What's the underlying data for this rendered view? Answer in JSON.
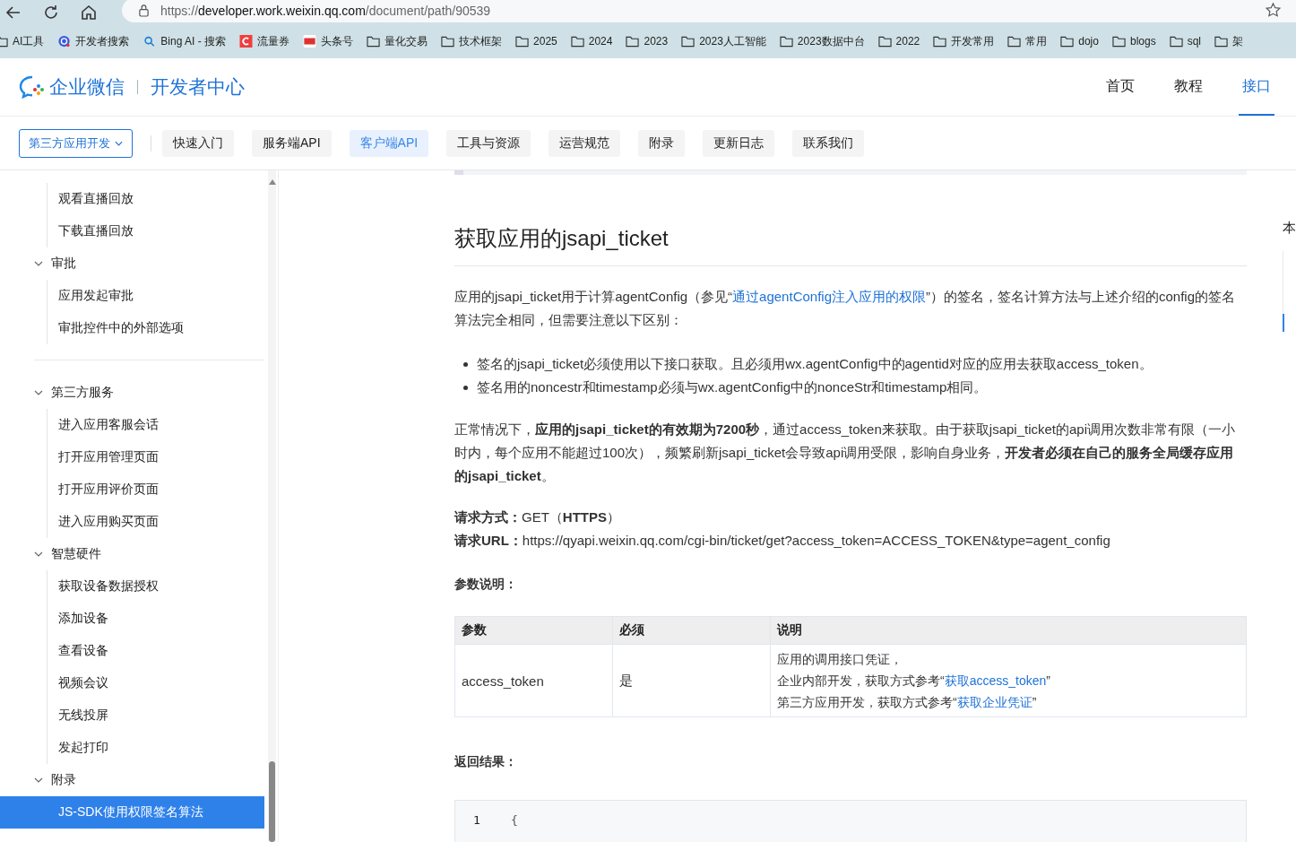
{
  "browser": {
    "url": {
      "scheme": "https://",
      "host": "developer.work.weixin.qq.com",
      "path": "/document/path/90539"
    },
    "bookmarks": [
      {
        "label": "AI工具",
        "kind": "folder"
      },
      {
        "label": "开发者搜索",
        "kind": "target"
      },
      {
        "label": "Bing AI - 搜索",
        "kind": "search"
      },
      {
        "label": "流量券",
        "kind": "c-logo"
      },
      {
        "label": "头条号",
        "kind": "news"
      },
      {
        "label": "量化交易",
        "kind": "folder"
      },
      {
        "label": "技术框架",
        "kind": "folder"
      },
      {
        "label": "2025",
        "kind": "folder"
      },
      {
        "label": "2024",
        "kind": "folder"
      },
      {
        "label": "2023",
        "kind": "folder"
      },
      {
        "label": "2023人工智能",
        "kind": "folder"
      },
      {
        "label": "2023数据中台",
        "kind": "folder"
      },
      {
        "label": "2022",
        "kind": "folder"
      },
      {
        "label": "开发常用",
        "kind": "folder"
      },
      {
        "label": "常用",
        "kind": "folder"
      },
      {
        "label": "dojo",
        "kind": "folder"
      },
      {
        "label": "blogs",
        "kind": "folder"
      },
      {
        "label": "sql",
        "kind": "folder"
      },
      {
        "label": "架",
        "kind": "folder"
      }
    ]
  },
  "header": {
    "brand": "企业微信",
    "section": "开发者中心",
    "nav": [
      {
        "label": "首页",
        "selected": false
      },
      {
        "label": "教程",
        "selected": false
      },
      {
        "label": "接口",
        "selected": true
      }
    ]
  },
  "subnav": {
    "dropdown": "第三方应用开发",
    "tabs": [
      {
        "label": "快速入门",
        "selected": false
      },
      {
        "label": "服务端API",
        "selected": false
      },
      {
        "label": "客户端API",
        "selected": true
      },
      {
        "label": "工具与资源",
        "selected": false
      },
      {
        "label": "运营规范",
        "selected": false
      },
      {
        "label": "附录",
        "selected": false
      },
      {
        "label": "更新日志",
        "selected": false
      },
      {
        "label": "联系我们",
        "selected": false
      }
    ]
  },
  "sidebar": {
    "tree": [
      {
        "children": [
          {
            "label": "观看直播回放",
            "selected": false
          },
          {
            "label": "下载直播回放",
            "selected": false
          }
        ]
      },
      {
        "label": "审批",
        "expanded": true,
        "children": [
          {
            "label": "应用发起审批",
            "selected": false
          },
          {
            "label": "审批控件中的外部选项",
            "selected": false
          }
        ]
      },
      {
        "kind": "divider"
      },
      {
        "label": "第三方服务",
        "expanded": true,
        "children": [
          {
            "label": "进入应用客服会话",
            "selected": false
          },
          {
            "label": "打开应用管理页面",
            "selected": false
          },
          {
            "label": "打开应用评价页面",
            "selected": false
          },
          {
            "label": "进入应用购买页面",
            "selected": false
          }
        ]
      },
      {
        "label": "智慧硬件",
        "expanded": true,
        "children": [
          {
            "label": "获取设备数据授权",
            "selected": false
          },
          {
            "label": "添加设备",
            "selected": false
          },
          {
            "label": "查看设备",
            "selected": false
          },
          {
            "label": "视频会议",
            "selected": false
          },
          {
            "label": "无线投屏",
            "selected": false
          },
          {
            "label": "发起打印",
            "selected": false
          }
        ]
      },
      {
        "label": "附录",
        "expanded": true,
        "children": [
          {
            "label": "JS-SDK使用权限签名算法",
            "selected": true
          }
        ]
      }
    ]
  },
  "article": {
    "title": "获取应用的jsapi_ticket",
    "intro": [
      {
        "kind": "text",
        "text": "应用的jsapi_ticket用于计算agentConfig（参见“"
      },
      {
        "kind": "link",
        "text": "通过agentConfig注入应用的权限"
      },
      {
        "kind": "text",
        "text": "”）的签名，签名计算方法与上述介绍的config的签名算法完全相同，但需要注意以下区别："
      }
    ],
    "bullets": [
      "签名的jsapi_ticket必须使用以下接口获取。且必须用wx.agentConfig中的agentid对应的应用去获取access_token。",
      "签名用的noncestr和timestamp必须与wx.agentConfig中的nonceStr和timestamp相同。"
    ],
    "note": "正常情况下，**应用的jsapi_ticket的有效期为7200秒**，通过access_token来获取。由于获取jsapi_ticket的api调用次数非常有限（一小时内，每个应用不能超过100次），频繁刷新jsapi_ticket会导致api调用受限，影响自身业务，**开发者必须在自己的服务全局缓存应用的jsapi_ticket**。",
    "request_method": "**请求方式：**GET（**HTTPS**）",
    "request_url": "**请求URL：**https://qyapi.weixin.qq.com/cgi-bin/ticket/get?access_token=ACCESS_TOKEN&type=agent_config",
    "params_heading": "参数说明：",
    "table": {
      "columns": [
        "参数",
        "必须",
        "说明"
      ],
      "rows": [
        {
          "cells": [
            "access_token",
            "是"
          ],
          "description": [
            [
              {
                "kind": "text",
                "text": "应用的调用接口凭证，"
              }
            ],
            [
              {
                "kind": "text",
                "text": "企业内部开发，获取方式参考“"
              },
              {
                "kind": "link",
                "text": "获取access_token"
              },
              {
                "kind": "text",
                "text": "”"
              }
            ],
            [
              {
                "kind": "text",
                "text": "第三方应用开发，获取方式参考“"
              },
              {
                "kind": "link",
                "text": "获取企业凭证"
              },
              {
                "kind": "text",
                "text": "”"
              }
            ]
          ]
        }
      ]
    },
    "result_heading": "返回结果：",
    "code": [
      {
        "number": "1",
        "text": "{"
      }
    ]
  },
  "toc": {
    "heading": "本"
  }
}
